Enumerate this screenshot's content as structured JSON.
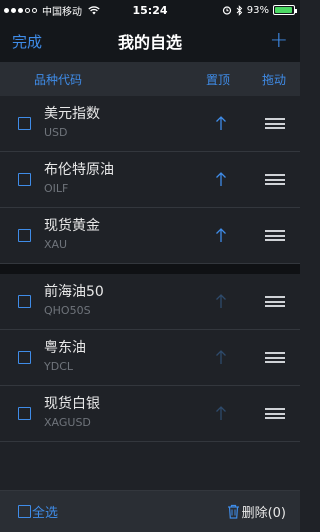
{
  "status_bar": {
    "carrier": "中国移动",
    "time": "15:24",
    "battery_percent": "93%",
    "battery_level": 0.93
  },
  "nav": {
    "done_label": "完成",
    "title": "我的自选",
    "add_label": "+"
  },
  "columns": {
    "name": "品种代码",
    "pin_top": "置顶",
    "drag": "拖动"
  },
  "section1": [
    {
      "name": "美元指数",
      "code": "USD"
    },
    {
      "name": "布伦特原油",
      "code": "OILF"
    },
    {
      "name": "现货黄金",
      "code": "XAU"
    }
  ],
  "section2": [
    {
      "name": "前海油50",
      "code": "QHO50S"
    },
    {
      "name": "粤东油",
      "code": "YDCL"
    },
    {
      "name": "现货白银",
      "code": "XAGUSD"
    }
  ],
  "bottom": {
    "select_all": "全选",
    "delete": "删除(0)"
  },
  "colors": {
    "accent": "#3f8ce8",
    "background": "#1f2227",
    "header_bg": "#2a2e34"
  }
}
